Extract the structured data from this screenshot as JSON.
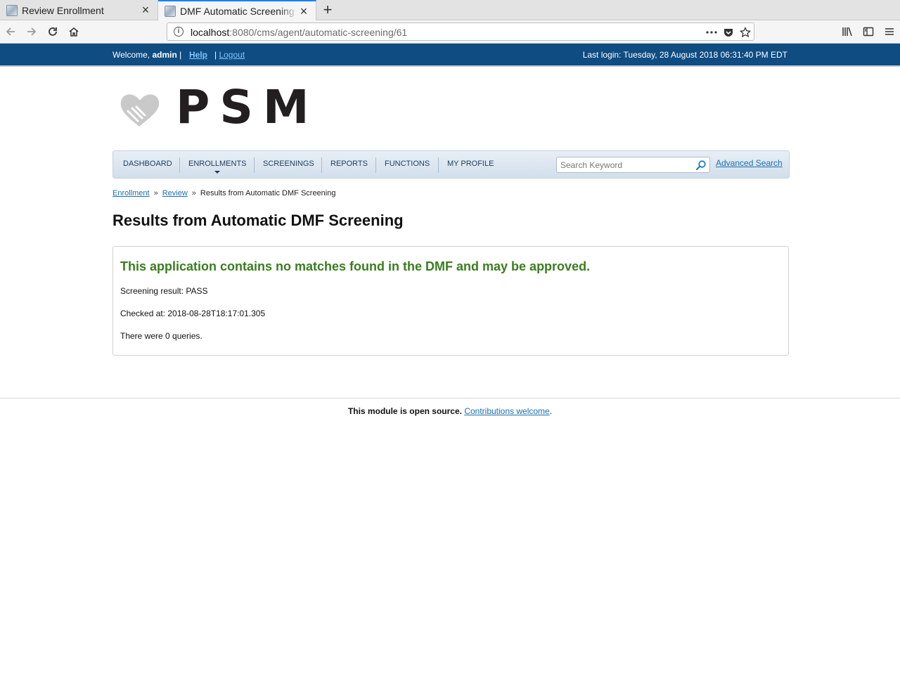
{
  "browser": {
    "tabs": [
      {
        "title": "Review Enrollment",
        "active": false
      },
      {
        "title": "DMF Automatic Screening",
        "active": true
      }
    ],
    "url": {
      "host": "localhost",
      "path": ":8080/cms/agent/automatic-screening/61"
    }
  },
  "header": {
    "welcome_prefix": "Welcome,",
    "username": "admin",
    "help_label": "Help",
    "logout_label": "Logout",
    "last_login": "Last login: Tuesday, 28 August 2018 06:31:40 PM EDT"
  },
  "logo_text": "PSM",
  "menu": {
    "items": [
      "DASHBOARD",
      "ENROLLMENTS",
      "SCREENINGS",
      "REPORTS",
      "FUNCTIONS",
      "MY PROFILE"
    ],
    "search_placeholder": "Search Keyword",
    "advanced_search_label": "Advanced Search"
  },
  "breadcrumb": {
    "items": [
      "Enrollment",
      "Review"
    ],
    "current": "Results from Automatic DMF Screening"
  },
  "page_title": "Results from Automatic DMF Screening",
  "result": {
    "headline": "This application contains no matches found in the DMF and may be approved.",
    "screening_result": "Screening result: PASS",
    "checked_at": "Checked at: 2018-08-28T18:17:01.305",
    "queries": "There were 0 queries."
  },
  "footer": {
    "text": "This module is open source.",
    "link_label": "Contributions welcome",
    "suffix": "."
  },
  "colors": {
    "header_bg": "#0f4c81",
    "link": "#1a6fae",
    "success": "#3a7d1f"
  }
}
